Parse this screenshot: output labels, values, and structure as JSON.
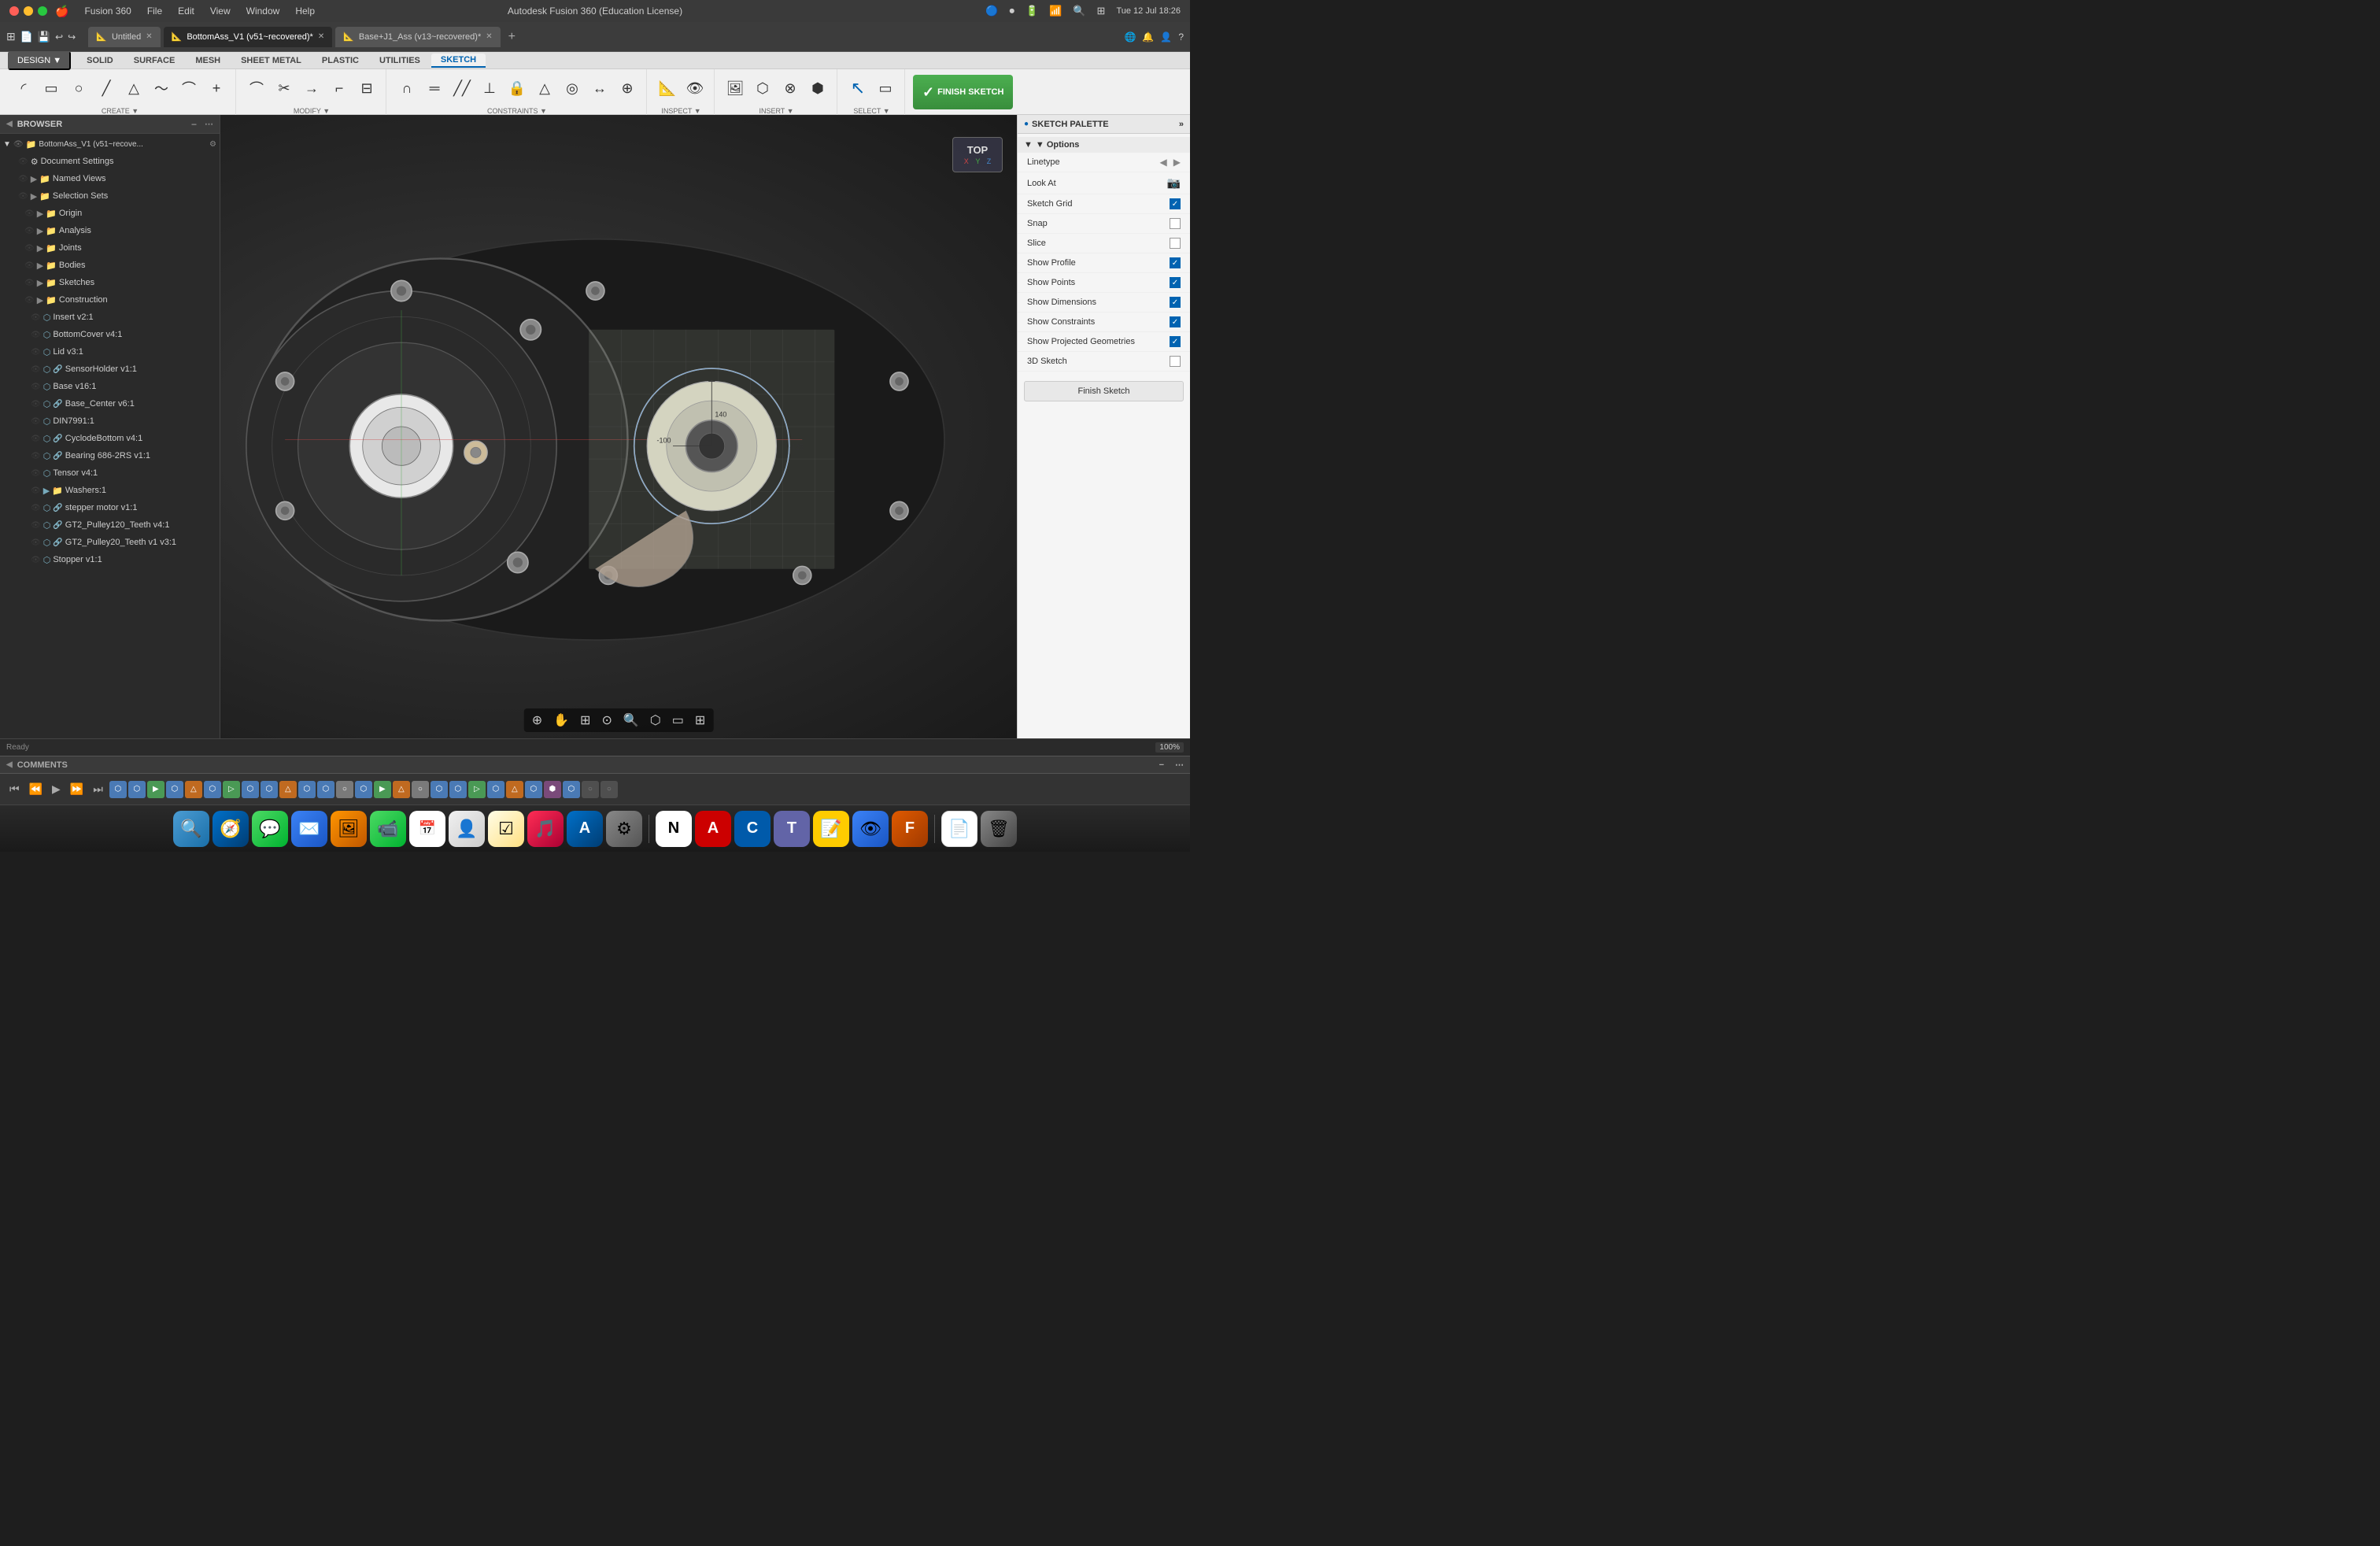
{
  "app": {
    "name": "Autodesk Fusion 360",
    "license": "(Education License)",
    "window_title": "Autodesk Fusion 360 (Education License)"
  },
  "titlebar": {
    "time": "Tue 12 Jul  18:26",
    "title": "Autodesk Fusion 360 (Education License)"
  },
  "tabs": [
    {
      "label": "Untitled",
      "active": false,
      "id": "untitled"
    },
    {
      "label": "BottomAss_V1 (v51~recovered)*",
      "active": true,
      "id": "bottomass"
    },
    {
      "label": "Base+J1_Ass (v13~recovered)*",
      "active": false,
      "id": "base"
    }
  ],
  "ribbon": {
    "design_btn": "DESIGN ▼",
    "tabs": [
      "SOLID",
      "SURFACE",
      "MESH",
      "SHEET METAL",
      "PLASTIC",
      "UTILITIES",
      "SKETCH"
    ],
    "active_tab": "SKETCH",
    "groups": [
      {
        "label": "CREATE ▼",
        "tools": [
          "arc",
          "rect",
          "circle",
          "line",
          "triangle",
          "line2",
          "curved",
          "plus"
        ]
      },
      {
        "label": "MODIFY ▼",
        "tools": [
          "trim",
          "offset",
          "move",
          "scale",
          "explode"
        ]
      },
      {
        "label": "CONSTRAINTS ▼",
        "tools": [
          "lock",
          "coincident",
          "horizontal",
          "perpendicular",
          "parallel",
          "tangent",
          "equal",
          "midpoint",
          "fix"
        ]
      },
      {
        "label": "INSPECT ▼",
        "tools": [
          "measure",
          "display"
        ]
      },
      {
        "label": "INSERT ▼",
        "tools": [
          "insert",
          "project"
        ]
      },
      {
        "label": "SELECT ▼",
        "tools": [
          "select",
          "window"
        ]
      },
      {
        "label": "FINISH SKETCH",
        "tools": [
          "finish"
        ]
      }
    ],
    "finish_sketch": "FINISH SKETCH"
  },
  "browser": {
    "title": "BROWSER",
    "root": "BottomAss_V1 (v51~recove...",
    "items": [
      {
        "level": 1,
        "label": "Document Settings",
        "icon": "gear",
        "eye": true
      },
      {
        "level": 1,
        "label": "Named Views",
        "icon": "folder",
        "eye": true
      },
      {
        "level": 1,
        "label": "Selection Sets",
        "icon": "folder",
        "eye": true
      },
      {
        "level": 2,
        "label": "Origin",
        "icon": "folder",
        "eye": true
      },
      {
        "level": 2,
        "label": "Analysis",
        "icon": "folder",
        "eye": true
      },
      {
        "level": 2,
        "label": "Joints",
        "icon": "folder",
        "eye": true
      },
      {
        "level": 2,
        "label": "Bodies",
        "icon": "folder",
        "eye": true
      },
      {
        "level": 2,
        "label": "Sketches",
        "icon": "folder",
        "eye": true
      },
      {
        "level": 2,
        "label": "Construction",
        "icon": "folder",
        "eye": true
      },
      {
        "level": 3,
        "label": "Insert v2:1",
        "icon": "component",
        "eye": true
      },
      {
        "level": 3,
        "label": "BottomCover v4:1",
        "icon": "component",
        "eye": true
      },
      {
        "level": 3,
        "label": "Lid v3:1",
        "icon": "component",
        "eye": true
      },
      {
        "level": 3,
        "label": "SensorHolder v1:1",
        "icon": "linked",
        "eye": true
      },
      {
        "level": 3,
        "label": "Base v16:1",
        "icon": "component",
        "eye": true
      },
      {
        "level": 3,
        "label": "Base_Center v6:1",
        "icon": "linked",
        "eye": true
      },
      {
        "level": 3,
        "label": "DIN7991:1",
        "icon": "component",
        "eye": true
      },
      {
        "level": 3,
        "label": "CyclodeBottom v4:1",
        "icon": "linked",
        "eye": true
      },
      {
        "level": 3,
        "label": "Bearing 686-2RS v1:1",
        "icon": "linked",
        "eye": true
      },
      {
        "level": 3,
        "label": "Tensor v4:1",
        "icon": "component",
        "eye": true
      },
      {
        "level": 3,
        "label": "Washers:1",
        "icon": "folder",
        "eye": true
      },
      {
        "level": 3,
        "label": "stepper motor v1:1",
        "icon": "linked",
        "eye": true
      },
      {
        "level": 3,
        "label": "GT2_Pulley120_Teeth v4:1",
        "icon": "linked",
        "eye": true
      },
      {
        "level": 3,
        "label": "GT2_Pulley20_Teeth v1 v3:1",
        "icon": "linked",
        "eye": true
      },
      {
        "level": 3,
        "label": "Stopper v1:1",
        "icon": "component",
        "eye": true
      }
    ]
  },
  "sketch_palette": {
    "title": "SKETCH PALETTE",
    "options_label": "▼ Options",
    "rows": [
      {
        "label": "Linetype",
        "type": "icon",
        "checked": false
      },
      {
        "label": "Look At",
        "type": "icon",
        "checked": false
      },
      {
        "label": "Sketch Grid",
        "type": "checkbox",
        "checked": true
      },
      {
        "label": "Snap",
        "type": "checkbox",
        "checked": false
      },
      {
        "label": "Slice",
        "type": "checkbox",
        "checked": false
      },
      {
        "label": "Show Profile",
        "type": "checkbox",
        "checked": true
      },
      {
        "label": "Show Points",
        "type": "checkbox",
        "checked": true
      },
      {
        "label": "Show Dimensions",
        "type": "checkbox",
        "checked": true
      },
      {
        "label": "Show Constraints",
        "type": "checkbox",
        "checked": true
      },
      {
        "label": "Show Projected Geometries",
        "type": "checkbox",
        "checked": true
      },
      {
        "label": "3D Sketch",
        "type": "checkbox",
        "checked": false
      }
    ],
    "finish_btn": "Finish Sketch"
  },
  "viewport": {
    "compass": "TOP"
  },
  "comments": {
    "label": "COMMENTS"
  },
  "timeline": {
    "controls": [
      "⏮",
      "⏪",
      "▶",
      "⏩",
      "⏭"
    ]
  },
  "dock": {
    "apps": [
      {
        "name": "Finder",
        "color": "#4b9cd3",
        "icon": "🔍"
      },
      {
        "name": "Safari",
        "color": "#0070c9",
        "icon": "🧭"
      },
      {
        "name": "Messages",
        "color": "#4cd964",
        "icon": "💬"
      },
      {
        "name": "Mail",
        "color": "#3b82f6",
        "icon": "✉️"
      },
      {
        "name": "Photos",
        "color": "#ff9500",
        "icon": "🖼"
      },
      {
        "name": "FaceTime",
        "color": "#4cd964",
        "icon": "📹"
      },
      {
        "name": "Calendar",
        "color": "#ff3b30",
        "icon": "📅"
      },
      {
        "name": "Contacts",
        "color": "#8e8e93",
        "icon": "👤"
      },
      {
        "name": "Reminders",
        "color": "#4cd964",
        "icon": "☑"
      },
      {
        "name": "Music",
        "color": "#ff2d55",
        "icon": "🎵"
      },
      {
        "name": "App Store",
        "color": "#0070c9",
        "icon": "A"
      },
      {
        "name": "System Preferences",
        "color": "#8e8e93",
        "icon": "⚙"
      },
      {
        "name": "Notion",
        "color": "#000000",
        "icon": "N"
      },
      {
        "name": "AutoCAD",
        "color": "#c00000",
        "icon": "A"
      },
      {
        "name": "CAM",
        "color": "#005aaa",
        "icon": "C"
      },
      {
        "name": "Teams",
        "color": "#6264a7",
        "icon": "T"
      },
      {
        "name": "Stickies",
        "color": "#ffcc00",
        "icon": "📝"
      },
      {
        "name": "Preview",
        "color": "#3b82f6",
        "icon": "👁"
      },
      {
        "name": "Fusion360",
        "color": "#e05a00",
        "icon": "F"
      },
      {
        "name": "TextEdit",
        "color": "#ffffff",
        "icon": "📄"
      },
      {
        "name": "Trash",
        "color": "#8e8e93",
        "icon": "🗑"
      }
    ]
  }
}
